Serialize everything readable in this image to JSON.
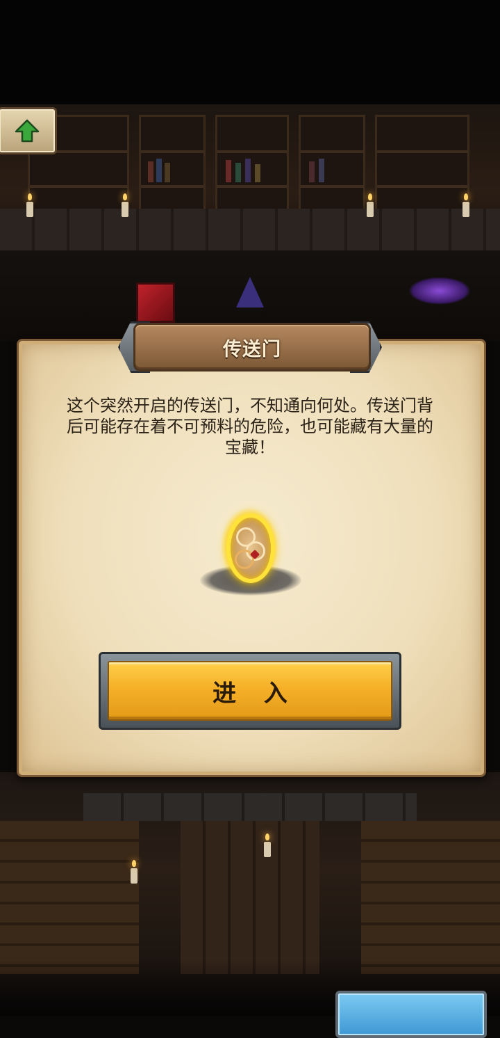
{
  "dialog": {
    "title": "传送门",
    "description": "这个突然开启的传送门，不知通向何处。传送门背后可能存在着不可预料的危险，也可能藏有大量的宝藏！",
    "enter_label": "进 入"
  },
  "icons": {
    "up_button": "up-arrow-icon",
    "portal": "portal-icon"
  },
  "colors": {
    "enter_button": "#f5b028",
    "up_arrow": "#3aa83a",
    "parchment": "#efdfbb",
    "plank": "#98704a",
    "blue_button": "#4ea8e0"
  }
}
